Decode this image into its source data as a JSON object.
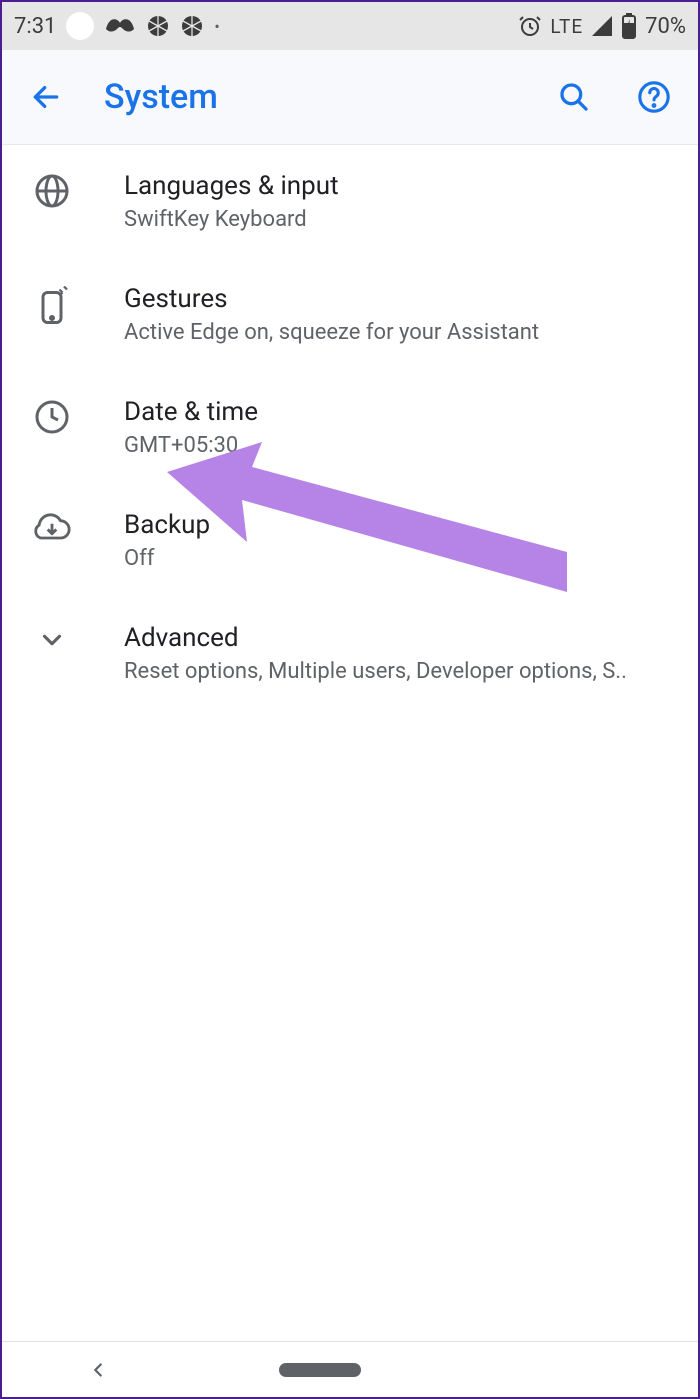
{
  "status": {
    "time": "7:31",
    "network": "LTE",
    "battery": "70%"
  },
  "header": {
    "title": "System"
  },
  "items": [
    {
      "title": "Languages & input",
      "subtitle": "SwiftKey Keyboard"
    },
    {
      "title": "Gestures",
      "subtitle": "Active Edge on, squeeze for your Assistant"
    },
    {
      "title": "Date & time",
      "subtitle": "GMT+05:30"
    },
    {
      "title": "Backup",
      "subtitle": "Off"
    },
    {
      "title": "Advanced",
      "subtitle": "Reset options, Multiple users, Developer options, S.."
    }
  ]
}
